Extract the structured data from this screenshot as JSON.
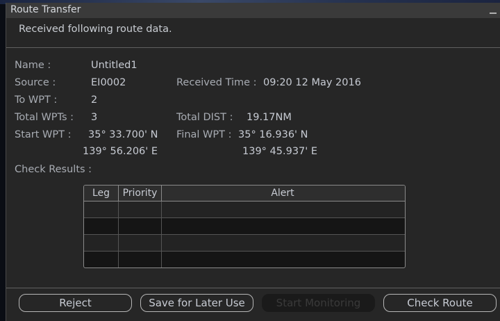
{
  "dialog": {
    "title": "Route Transfer",
    "subtitle": "Received following route data."
  },
  "fields": {
    "name_label": "Name :",
    "name_value": "Untitled1",
    "source_label": "Source :",
    "source_value": "EI0002",
    "received_time_label": "Received Time :",
    "received_time_value": "09:20  12 May 2016",
    "to_wpt_label": "To WPT :",
    "to_wpt_value": "2",
    "total_wpts_label": "Total WPTs :",
    "total_wpts_value": "3",
    "total_dist_label": "Total DIST :",
    "total_dist_value": "19.17NM",
    "start_wpt_label": "Start WPT :",
    "start_wpt_lat": "35° 33.700' N",
    "start_wpt_lon": "139° 56.206' E",
    "final_wpt_label": "Final WPT :",
    "final_wpt_lat": "35° 16.936' N",
    "final_wpt_lon": "139° 45.937' E",
    "check_results_label": "Check Results :"
  },
  "check_table": {
    "columns": [
      "Leg",
      "Priority",
      "Alert"
    ],
    "rows": [
      [
        "",
        "",
        ""
      ],
      [
        "",
        "",
        ""
      ],
      [
        "",
        "",
        ""
      ],
      [
        "",
        "",
        ""
      ]
    ]
  },
  "buttons": {
    "reject": "Reject",
    "save_later": "Save for Later Use",
    "start_monitoring": "Start Monitoring",
    "check_route": "Check Route"
  },
  "colors": {
    "dialog_bg": "#262626",
    "title_bar_bg": "#3a3a3a",
    "text": "#c7cbd3",
    "disabled_button_bg": "#1a1a1a"
  }
}
